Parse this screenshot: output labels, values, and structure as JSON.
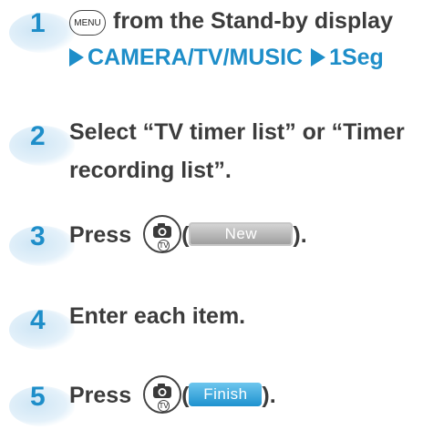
{
  "steps": [
    {
      "number": "1",
      "line1_text": "from the Stand-by display",
      "menu_key_label": "MENU",
      "nav_items": [
        "CAMERA/TV/MUSIC",
        "1Seg"
      ]
    },
    {
      "number": "2",
      "line1": "Select “TV timer list” or “Timer",
      "line2": "recording list”."
    },
    {
      "number": "3",
      "prefix": "Press",
      "open_paren": "(",
      "close_paren": ").",
      "key_sub_label": "TV",
      "softkey_label": "New"
    },
    {
      "number": "4",
      "text": "Enter each item."
    },
    {
      "number": "5",
      "prefix": "Press",
      "open_paren": "(",
      "close_paren": ").",
      "key_sub_label": "TV",
      "softkey_label": "Finish"
    }
  ],
  "colors": {
    "step_number": "#1e8ec9",
    "nav_text": "#1e8ec9",
    "body_text": "#3c3c3c",
    "softkey_new": "#a8a8a8",
    "softkey_finish": "#2ba3dd"
  },
  "icons": [
    "menu-key-icon",
    "camera-tv-key-icon",
    "triangle-arrow-icon"
  ]
}
